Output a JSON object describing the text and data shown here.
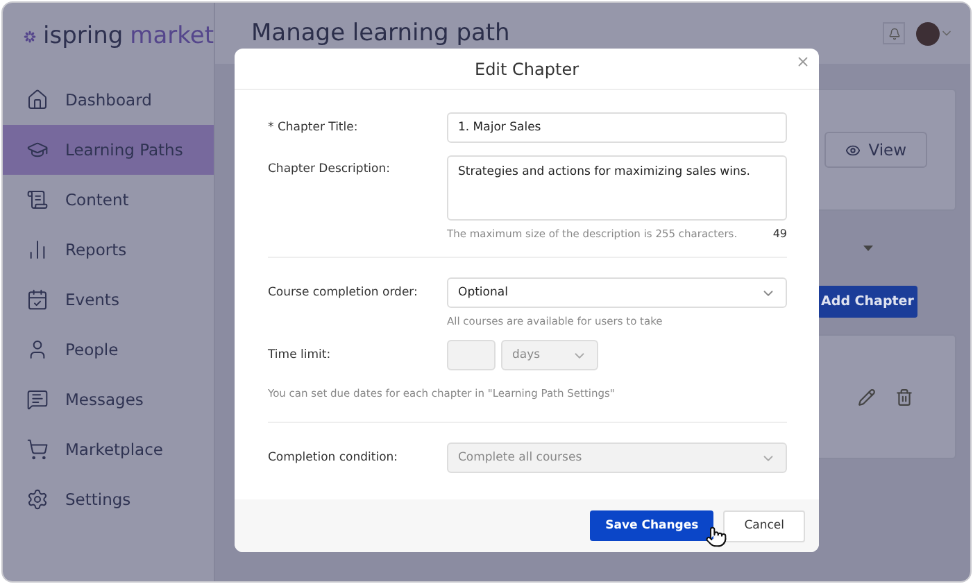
{
  "logo": {
    "name": "ispring",
    "suffix": "market"
  },
  "sidebar": {
    "items": [
      {
        "label": "Dashboard",
        "selected": false
      },
      {
        "label": "Learning Paths",
        "selected": true
      },
      {
        "label": "Content",
        "selected": false
      },
      {
        "label": "Reports",
        "selected": false
      },
      {
        "label": "Events",
        "selected": false
      },
      {
        "label": "People",
        "selected": false
      },
      {
        "label": "Messages",
        "selected": false
      },
      {
        "label": "Marketplace",
        "selected": false
      },
      {
        "label": "Settings",
        "selected": false
      }
    ]
  },
  "header": {
    "title": "Manage learning path"
  },
  "page": {
    "view_button": "View",
    "add_chapter_button": "Add Chapter"
  },
  "dialog": {
    "title": "Edit Chapter",
    "chapter_title": {
      "label": "* Chapter Title:",
      "value": "1. Major Sales"
    },
    "chapter_description": {
      "label": "Chapter Description:",
      "value": "Strategies and actions for maximizing sales wins.",
      "hint": "The maximum size of the description is 255 characters.",
      "counter": "49"
    },
    "completion_order": {
      "label": "Course completion order:",
      "value": "Optional",
      "hint": "All courses are available for users to take",
      "disabled": false
    },
    "time_limit": {
      "label": "Time limit:",
      "unit": "days",
      "disabled": true,
      "hint": "You can set due dates for each chapter in \"Learning Path Settings\""
    },
    "completion_condition": {
      "label": "Completion condition:",
      "value": "Complete all courses",
      "disabled": true
    },
    "buttons": {
      "save": "Save Changes",
      "cancel": "Cancel"
    }
  }
}
